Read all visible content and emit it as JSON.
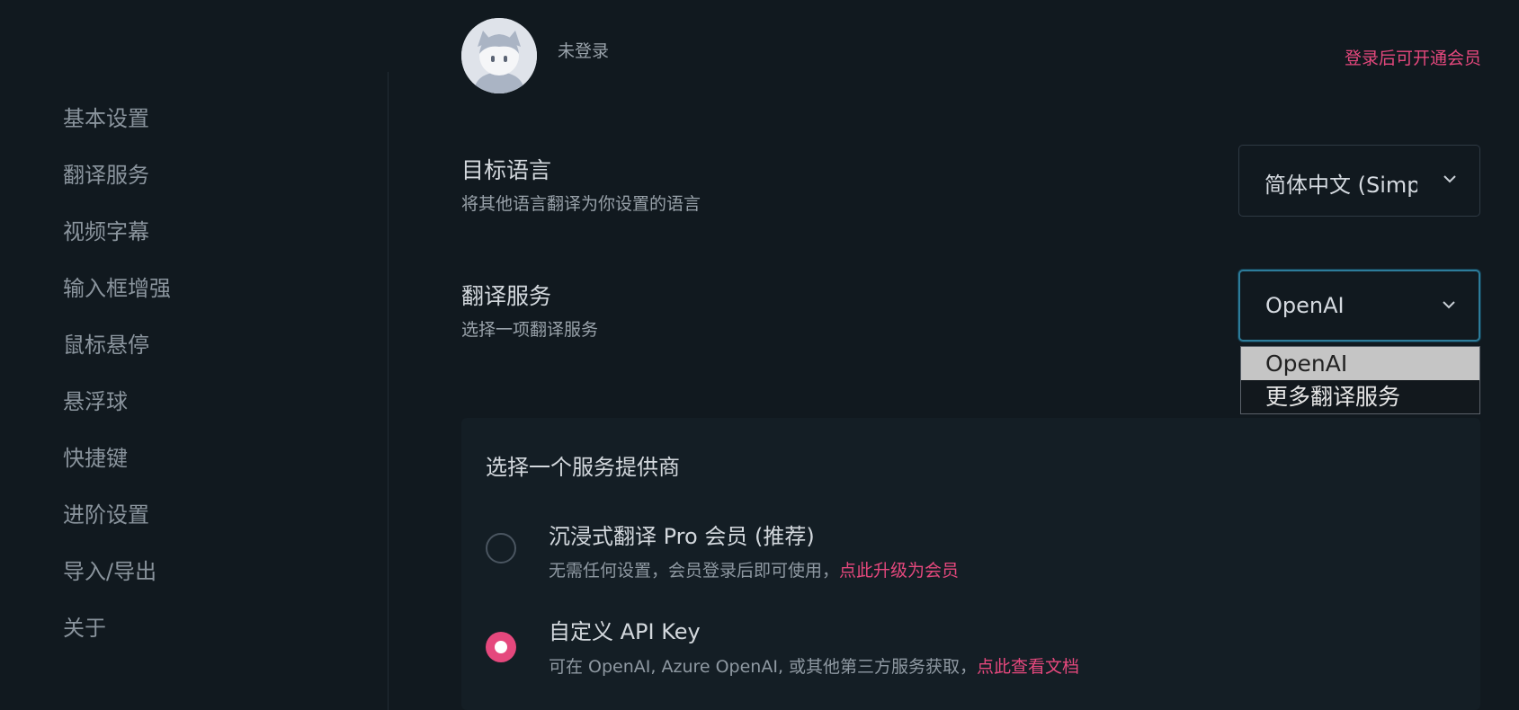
{
  "sidebar": {
    "items": [
      {
        "label": "基本设置"
      },
      {
        "label": "翻译服务"
      },
      {
        "label": "视频字幕"
      },
      {
        "label": "输入框增强"
      },
      {
        "label": "鼠标悬停"
      },
      {
        "label": "悬浮球"
      },
      {
        "label": "快捷键"
      },
      {
        "label": "进阶设置"
      },
      {
        "label": "导入/导出"
      },
      {
        "label": "关于"
      }
    ]
  },
  "header": {
    "login_status": "未登录",
    "vip_link": "登录后可开通会员"
  },
  "target_language": {
    "title": "目标语言",
    "description": "将其他语言翻译为你设置的语言",
    "value": "简体中文 (Simplified Chinese)"
  },
  "translation_service": {
    "title": "翻译服务",
    "description": "选择一项翻译服务",
    "value": "OpenAI",
    "options": [
      "OpenAI",
      "更多翻译服务"
    ]
  },
  "provider_panel": {
    "title": "选择一个服务提供商",
    "options": [
      {
        "title": "沉浸式翻译 Pro 会员 (推荐)",
        "desc": "无需任何设置，会员登录后即可使用，",
        "link": "点此升级为会员",
        "selected": false
      },
      {
        "title": "自定义 API Key",
        "desc": "可在 OpenAI, Azure OpenAI, 或其他第三方服务获取，",
        "link": "点此查看文档",
        "selected": true
      }
    ]
  },
  "colors": {
    "background": "#11191f",
    "accent_pink": "#e5487d",
    "focus_border": "#2d7c9a"
  }
}
